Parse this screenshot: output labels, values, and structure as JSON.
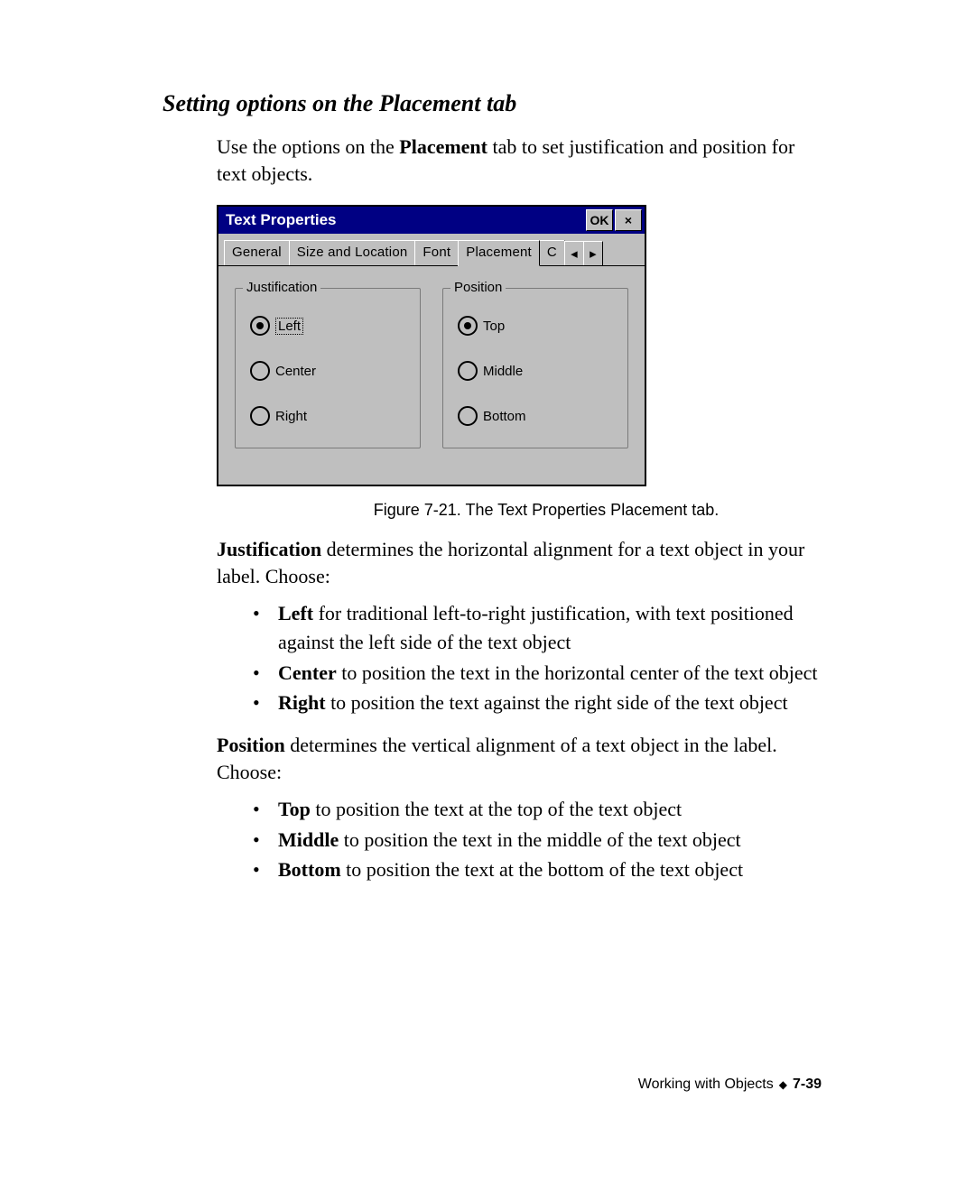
{
  "heading": "Setting options on the Placement tab",
  "intro_pre": "Use the options on the ",
  "intro_bold": "Placement",
  "intro_post": " tab to set justification and position for text objects.",
  "dialog": {
    "title": "Text Properties",
    "ok": "OK",
    "close": "×",
    "tabs": {
      "general": "General",
      "size": "Size and Location",
      "font": "Font",
      "placement": "Placement",
      "overflow": "C",
      "left_arrow": "◂",
      "right_arrow": "▸"
    },
    "justification": {
      "legend": "Justification",
      "left": "Left",
      "center": "Center",
      "right": "Right"
    },
    "position": {
      "legend": "Position",
      "top": "Top",
      "middle": "Middle",
      "bottom": "Bottom"
    }
  },
  "caption": "Figure 7-21. The Text Properties Placement tab.",
  "para_just_bold": "Justification",
  "para_just_rest": " determines the horizontal alignment for a text object in your label. Choose:",
  "just_items": {
    "left_b": "Left",
    "left_t": " for traditional left-to-right justification, with text positioned against the left side of the text object",
    "center_b": "Center",
    "center_t": " to position the text in the horizontal center of the text object",
    "right_b": "Right",
    "right_t": " to position the text against the right side of the text object"
  },
  "para_pos_bold": "Position",
  "para_pos_rest": " determines the vertical alignment of a text object in the label. Choose:",
  "pos_items": {
    "top_b": "Top",
    "top_t": " to position the text at the top of the text object",
    "middle_b": "Middle",
    "middle_t": " to position the text in the middle of the text object",
    "bottom_b": "Bottom",
    "bottom_t": " to position the text at the bottom of the text object"
  },
  "footer": {
    "section": "Working with Objects",
    "diamond": "◆",
    "page": "7-39"
  }
}
